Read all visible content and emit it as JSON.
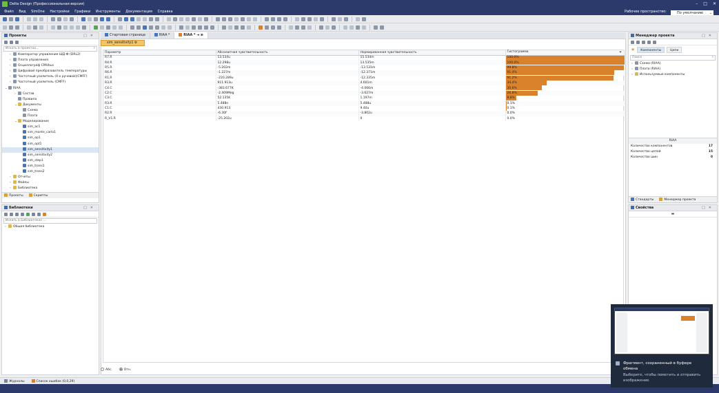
{
  "app": {
    "title": "Delta Design (Профессиональная версия)",
    "menu": [
      "Файл",
      "Вид",
      "SimOne",
      "Настройки",
      "Графики",
      "Инструменты",
      "Документация",
      "Справка"
    ],
    "workspace_label": "Рабочее пространство:",
    "workspace_value": "По умолчанию"
  },
  "projects_panel": {
    "title": "Проекты",
    "search_placeholder": "Искать в проектах...",
    "tree": [
      {
        "label": "Компаратор управления ШД-Ф (DRL2)",
        "indent": 1,
        "arrow": "›",
        "icon": "doc"
      },
      {
        "label": "Плата управления",
        "indent": 1,
        "arrow": "›",
        "icon": "doc"
      },
      {
        "label": "Осциллограф CMVbus",
        "indent": 1,
        "arrow": "›",
        "icon": "doc"
      },
      {
        "label": "Цифровой преобразователь температуры",
        "indent": 1,
        "arrow": "›",
        "icon": "doc"
      },
      {
        "label": "Частотный усилитель (4-х ручевой)(CMFF)",
        "indent": 1,
        "arrow": "›",
        "icon": "doc"
      },
      {
        "label": "Частотный усилитель (CMFF)",
        "indent": 1,
        "arrow": "›",
        "icon": "doc"
      },
      {
        "label": "RIAA",
        "indent": 0,
        "arrow": "⌄",
        "icon": "doc"
      },
      {
        "label": "Состав",
        "indent": 2,
        "arrow": "›",
        "icon": "doc"
      },
      {
        "label": "Правила",
        "indent": 2,
        "arrow": "",
        "icon": "doc"
      },
      {
        "label": "Документы",
        "indent": 2,
        "arrow": "⌄",
        "icon": "fold"
      },
      {
        "label": "Схема",
        "indent": 3,
        "arrow": "",
        "icon": "doc"
      },
      {
        "label": "Плата",
        "indent": 3,
        "arrow": "",
        "icon": "doc"
      },
      {
        "label": "Моделирование",
        "indent": 2,
        "arrow": "⌄",
        "icon": "fold"
      },
      {
        "label": "sim_ac1",
        "indent": 3,
        "arrow": "",
        "icon": "sim"
      },
      {
        "label": "sim_monte_carlo1",
        "indent": 3,
        "arrow": "",
        "icon": "sim"
      },
      {
        "label": "sim_op1",
        "indent": 3,
        "arrow": "",
        "icon": "sim"
      },
      {
        "label": "sim_opt1",
        "indent": 3,
        "arrow": "",
        "icon": "sim"
      },
      {
        "label": "sim_sensitivity1",
        "indent": 3,
        "arrow": "",
        "icon": "sim",
        "selected": true
      },
      {
        "label": "sim_sensitivity2",
        "indent": 3,
        "arrow": "",
        "icon": "sim"
      },
      {
        "label": "sim_step1",
        "indent": 3,
        "arrow": "",
        "icon": "sim"
      },
      {
        "label": "sim_trans1",
        "indent": 3,
        "arrow": "",
        "icon": "sim"
      },
      {
        "label": "sim_trans2",
        "indent": 3,
        "arrow": "",
        "icon": "sim"
      },
      {
        "label": "Отчеты",
        "indent": 1,
        "arrow": "›",
        "icon": "fold"
      },
      {
        "label": "Файлы",
        "indent": 1,
        "arrow": "›",
        "icon": "fold"
      },
      {
        "label": "Библиотека",
        "indent": 1,
        "arrow": "›",
        "icon": "fold"
      }
    ],
    "bottom_tabs": [
      "Проекты",
      "Скрипты"
    ]
  },
  "libraries_panel": {
    "title": "Библиотеки",
    "search_placeholder": "Искать в Библиотеках ...",
    "tree": [
      {
        "label": "Общая библиотека"
      }
    ]
  },
  "doc_tabs": [
    {
      "label": "Стартовая страница",
      "active": false
    },
    {
      "label": "RIAA *",
      "active": false
    },
    {
      "label": "RIAA *",
      "active": true
    }
  ],
  "sim_tab": "sim_sensitivity1",
  "table": {
    "headers": [
      "Параметр",
      "Абсолютная чувствительность",
      "Нормированная чувствительность",
      "Гистограмма"
    ],
    "rows": [
      {
        "param": "R7.R",
        "abs": "13.534u",
        "norm": "15.534m",
        "hist": "100.0%",
        "pct": 100
      },
      {
        "param": "R4.R",
        "abs": "12.298u",
        "norm": "13.535m",
        "hist": "100.0%",
        "pct": 100
      },
      {
        "param": "R5.R",
        "abs": "-5.202m",
        "norm": "-13.531m",
        "hist": "99.8%",
        "pct": 99.8
      },
      {
        "param": "R6.R",
        "abs": "-1.227m",
        "norm": "-12.371m",
        "hist": "91.4%",
        "pct": 91.4
      },
      {
        "param": "R1.R",
        "abs": "-220.289u",
        "norm": "-12.335m",
        "hist": "91.2%",
        "pct": 91.2
      },
      {
        "param": "R3.R",
        "abs": "911.913u",
        "norm": "4.601m",
        "hist": "34.4%",
        "pct": 34.4
      },
      {
        "param": "C4.C",
        "abs": "-383.677K",
        "norm": "-4.066m",
        "hist": "30.6%",
        "pct": 30.6
      },
      {
        "param": "C2.C",
        "abs": "-2.409Meg",
        "norm": "-3.627m",
        "hist": "26.8%",
        "pct": 26.8
      },
      {
        "param": "C3.C",
        "abs": "52.135K",
        "norm": "1.197m",
        "hist": "8.8%",
        "pct": 8.8
      },
      {
        "param": "R3.R",
        "abs": "5.488n",
        "norm": "5.488u",
        "hist": "0.1%",
        "pct": 0.1
      },
      {
        "param": "C1.C",
        "abs": "430.913",
        "norm": "9.40u",
        "hist": "0.1%",
        "pct": 0.1
      },
      {
        "param": "R2.R",
        "abs": "-6.30f",
        "norm": "-3.802u",
        "hist": "0.0%",
        "pct": 0
      },
      {
        "param": "R_V1.R",
        "abs": "-25.202u",
        "norm": "0",
        "hist": "0.0%",
        "pct": 0
      }
    ]
  },
  "radio": {
    "abs": "Абс.",
    "rel": "Отн."
  },
  "project_manager": {
    "title": "Менеджер проекта",
    "tabs": [
      "Компоненты",
      "Цепи"
    ],
    "search_placeholder": "Поиск",
    "tree": [
      "Схема (RIAA)",
      "Плата (RIAA)",
      "Используемые компоненты"
    ],
    "stats_title": "RIAA",
    "stats": [
      {
        "label": "Количество компонентов",
        "value": "17"
      },
      {
        "label": "Количество цепей",
        "value": "15"
      },
      {
        "label": "Количество шин",
        "value": "0"
      }
    ],
    "bottom_tabs": [
      "Стандарты",
      "Менеджер проекта"
    ]
  },
  "properties": {
    "title": "Свойства"
  },
  "statusbar": [
    "Журналы",
    "Список ошибок (0,0,29)"
  ],
  "toast": {
    "message": "Фрагмент, сохраненный в буфере обмена",
    "sub": "Выберите, чтобы пометить и отправить изображение"
  }
}
